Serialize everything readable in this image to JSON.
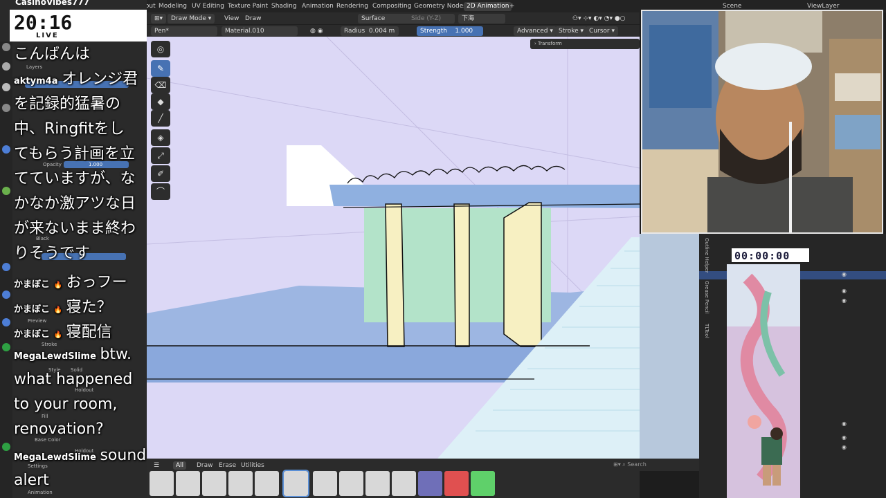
{
  "topbar": {
    "tabs": [
      "Layout",
      "Modeling",
      "UV Editing",
      "Texture Paint",
      "Shading",
      "Animation",
      "Rendering",
      "Compositing",
      "Geometry Nodes",
      "2D Animation",
      "+"
    ],
    "active_tab": "2D Animation",
    "scene": "Scene",
    "view_layer": "ViewLayer"
  },
  "header": {
    "mode": "Draw Mode",
    "view": "View",
    "draw": "Draw",
    "surface": "Surface",
    "side": "Side (Y-Z)",
    "layer_menu": "下海"
  },
  "toolsettings": {
    "brush": "Pen*",
    "material": "Material.010",
    "radius_label": "Radius",
    "radius_value": "0.004 m",
    "strength_label": "Strength",
    "strength_value": "1.000",
    "advanced": "Advanced",
    "stroke": "Stroke",
    "cursor": "Cursor",
    "transform": "Transform"
  },
  "clock": {
    "time": "20:16",
    "live": "LIVE"
  },
  "channel": "CasinoVibes777",
  "blender_left": {
    "layers": "Layers",
    "opacity_label": "Opacity",
    "opacity_value": "1.000",
    "black": "Black",
    "preview": "Preview",
    "stroke": "Stroke",
    "style_label": "Style",
    "style_value": "Solid",
    "holdout": "Holdout",
    "fill": "Fill",
    "base_color": "Base Color",
    "holdout2": "Holdout",
    "settings": "Settings",
    "animation": "Animation"
  },
  "chat": [
    {
      "line": "こんばんは"
    },
    {
      "user": "aktym4a",
      "msg": "オレンジ君"
    },
    {
      "line": "を記録的猛暑の"
    },
    {
      "line": "中、Ringfitをし"
    },
    {
      "line": "てもらう計画を立"
    },
    {
      "line": "てていますが、な"
    },
    {
      "line": "かなか激アツな日"
    },
    {
      "line": "が来ないまま終わ"
    },
    {
      "line": "りそうです"
    },
    {
      "user": "かまぼこ",
      "msg": "おっフー"
    },
    {
      "user": "かまぼこ",
      "msg": "寝た？"
    },
    {
      "user": "かまぼこ",
      "msg": "寝配信"
    },
    {
      "user": "MegaLewdSlime",
      "msg": "btw."
    },
    {
      "line": "what happened"
    },
    {
      "line": "to your room,"
    },
    {
      "line": "renovation?"
    },
    {
      "user": "MegaLewdSlime",
      "msg": "sound"
    },
    {
      "line": "alert"
    }
  ],
  "timer": "00:00:00",
  "right_tabs": [
    "Outline Helper",
    "Grease Pencil",
    "TLTool"
  ],
  "assetbar": {
    "tabs": [
      "All",
      "Draw",
      "Erase",
      "Utilities"
    ],
    "search_placeholder": "Search"
  },
  "colors": {
    "accent": "#4772b3",
    "viewport_bg": "#dcd8f6",
    "panel": "#2b2b2b"
  }
}
